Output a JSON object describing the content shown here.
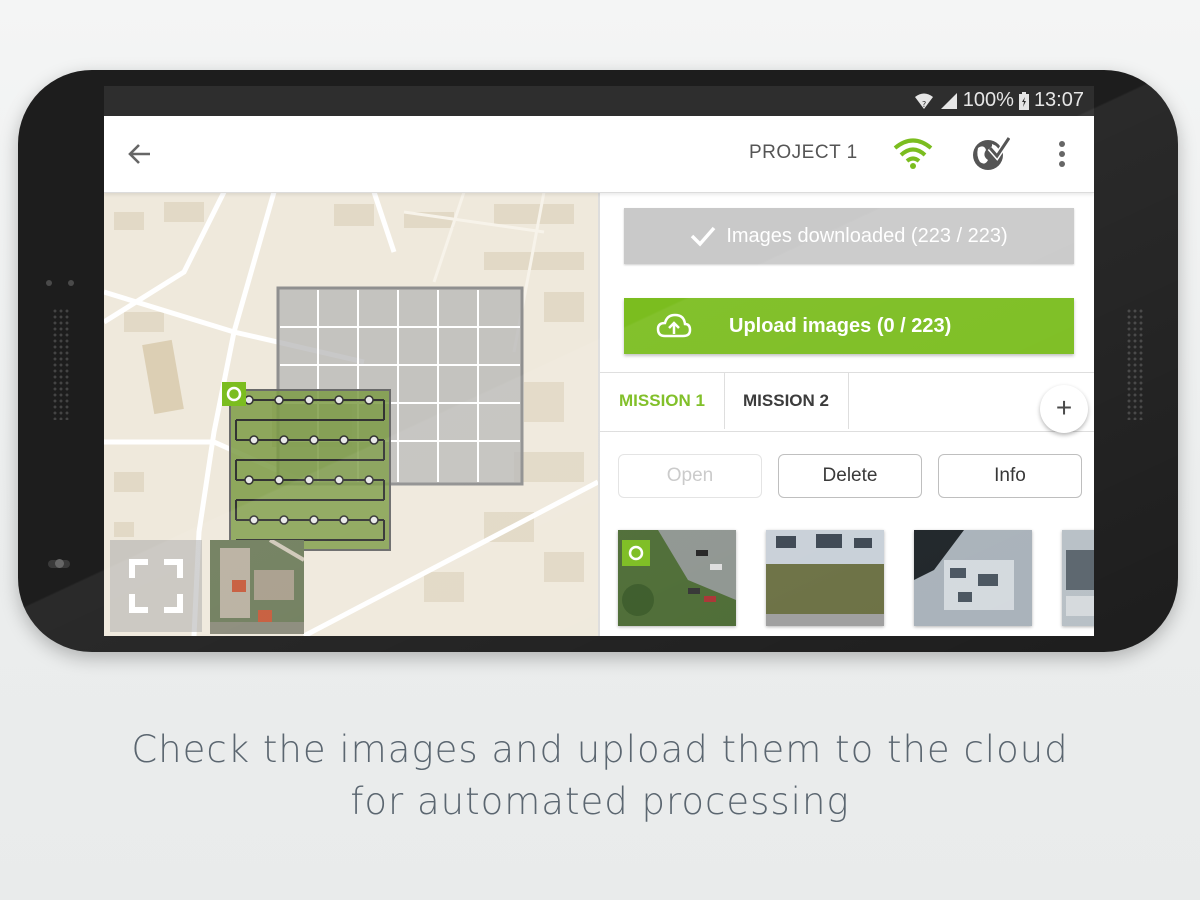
{
  "status_bar": {
    "battery": "100%",
    "time": "13:07"
  },
  "app_bar": {
    "title": "PROJECT 1"
  },
  "panel": {
    "downloaded_label": "Images downloaded (223 / 223)",
    "upload_label": "Upload images (0 / 223)",
    "tabs": [
      {
        "label": "MISSION 1",
        "active": true
      },
      {
        "label": "MISSION 2",
        "active": false
      }
    ],
    "add_label": "+",
    "actions": {
      "open": "Open",
      "delete": "Delete",
      "info": "Info"
    }
  },
  "caption": {
    "line1": "Check the images and upload them to the cloud",
    "line2": "for automated processing"
  },
  "colors": {
    "accent": "#7bbd1f",
    "disabled": "#c9c9c9",
    "status_bar": "#2e2e2e"
  }
}
